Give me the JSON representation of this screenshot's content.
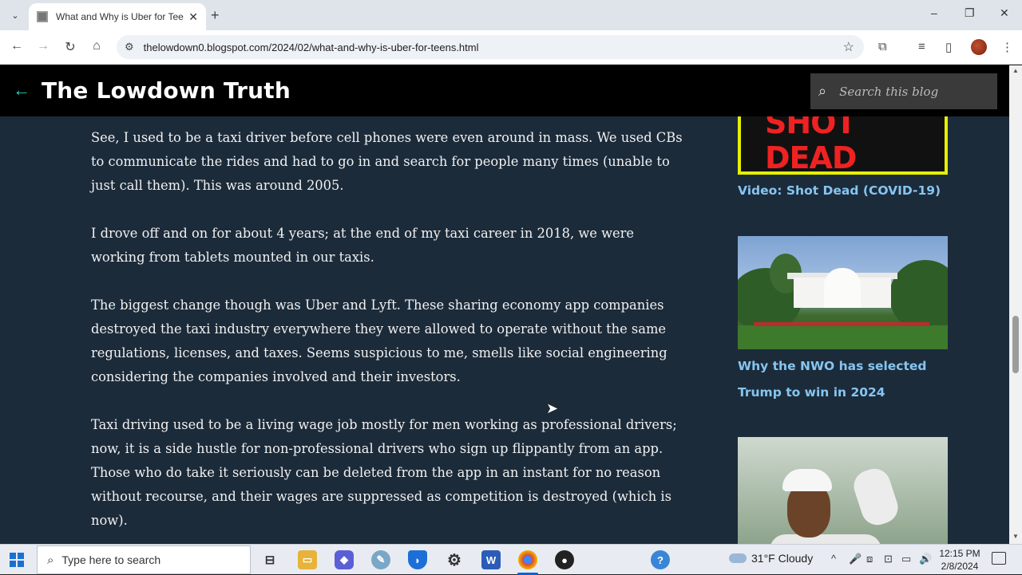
{
  "browser": {
    "tab_title": "What and Why is Uber for Teen",
    "url": "thelowdown0.blogspot.com/2024/02/what-and-why-is-uber-for-teens.html",
    "window_controls": {
      "minimize": "–",
      "maximize": "❐",
      "close": "✕"
    },
    "nav": {
      "back": "←",
      "forward": "→",
      "reload": "↻",
      "home": "⌂"
    }
  },
  "blog": {
    "title": "The Lowdown Truth",
    "search_placeholder": "Search this blog"
  },
  "article": {
    "paragraphs": [
      "See, I used to be a taxi driver before cell phones were even around in mass. We used CBs to communicate the rides and had to go in and search for people many times (unable to just call them). This was around 2005.",
      "I drove off and on for about 4 years; at the end of my taxi career in 2018, we were working from tablets mounted in our taxis.",
      "The biggest change though was Uber and Lyft. These sharing economy app companies destroyed the taxi industry everywhere they were allowed to operate without the same regulations, licenses, and taxes. Seems suspicious to me, smells like social engineering considering the companies involved and their investors.",
      "Taxi driving used to be a living wage job mostly for men working as professional drivers; now, it is a side hustle for non-professional drivers who sign up flippantly from an app. Those who do take it seriously can be deleted from the app in an instant for no reason without recourse, and their wages are suppressed as competition is destroyed (which is now)."
    ]
  },
  "sidebar": {
    "thumb1_text": "SHOT DEAD",
    "posts": [
      {
        "title": "Video: Shot Dead (COVID-19)"
      },
      {
        "title_line1": "Why the NWO has selected",
        "title_line2": "Trump to win in 2024"
      }
    ]
  },
  "taskbar": {
    "search_placeholder": "Type here to search",
    "weather": "31°F  Cloudy",
    "time": "12:15 PM",
    "date": "2/8/2024"
  },
  "colors": {
    "page_bg": "#1c2b3a",
    "header_bg": "#000000",
    "accent": "#2ad1b5",
    "link": "#86c5f0"
  }
}
